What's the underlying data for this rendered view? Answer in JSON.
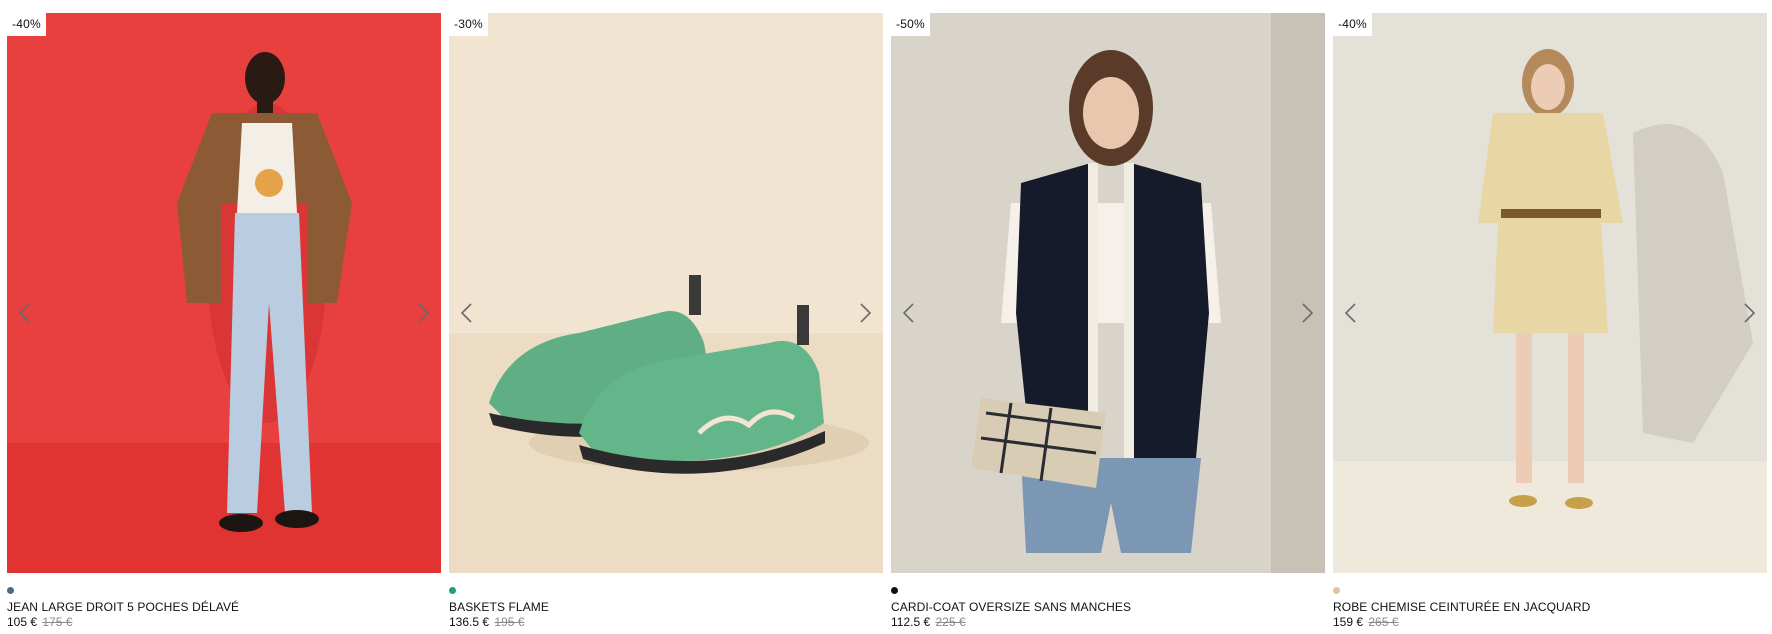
{
  "products": [
    {
      "discount": "-40%",
      "name": "JEAN LARGE DROIT 5 POCHES DÉLAVÉ",
      "price": "105 €",
      "old_price": "175 €",
      "swatch_color": "#4a6a8a",
      "image_bg": "#e8403e",
      "image_icon": "model-in-jeans-image"
    },
    {
      "discount": "-30%",
      "name": "BASKETS FLAME",
      "price": "136.5 €",
      "old_price": "195 €",
      "swatch_color": "#1aa07a",
      "image_bg": "#f1e4d0",
      "image_icon": "green-sneakers-image"
    },
    {
      "discount": "-50%",
      "name": "CARDI-COAT OVERSIZE SANS MANCHES",
      "price": "112.5 €",
      "old_price": "225 €",
      "swatch_color": "#111111",
      "image_bg": "#d9d4c9",
      "image_icon": "model-in-vest-image"
    },
    {
      "discount": "-40%",
      "name": "ROBE CHEMISE CEINTURÉE EN JACQUARD",
      "price": "159 €",
      "old_price": "265 €",
      "swatch_color": "#e2c3a0",
      "image_bg": "#dedad0",
      "image_icon": "model-in-dress-image"
    }
  ],
  "icons": {
    "prev": "chevron-left-icon",
    "next": "chevron-right-icon"
  }
}
